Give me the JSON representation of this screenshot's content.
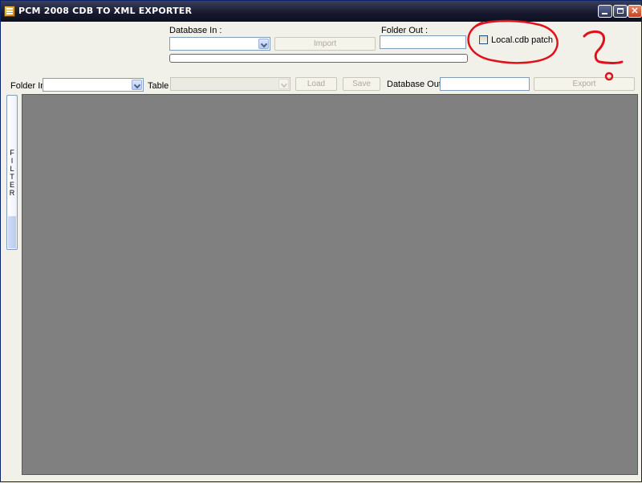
{
  "window": {
    "title": "PCM 2008 CDB TO XML EXPORTER",
    "controls": {
      "minimize": "_",
      "maximize": "□",
      "close": "✕"
    }
  },
  "import_section": {
    "database_in_label": "Database In :",
    "database_in_value": "",
    "import_button": "Import",
    "folder_out_label": "Folder Out :",
    "folder_out_value": "",
    "local_patch_label": "Local.cdb patch",
    "local_patch_checked": false,
    "progress": 0
  },
  "toolbar": {
    "folder_in_label": "Folder In :",
    "folder_in_value": "",
    "table_label": "Table :",
    "table_value": "",
    "load_button": "Load",
    "save_button": "Save",
    "database_out_label": "Database Out :",
    "database_out_value": "",
    "export_button": "Export"
  },
  "sidebar": {
    "filter_label": "FILTER"
  },
  "colors": {
    "annotation": "#E0111A",
    "grid_background": "#808080",
    "titlebar": "#16192E"
  }
}
